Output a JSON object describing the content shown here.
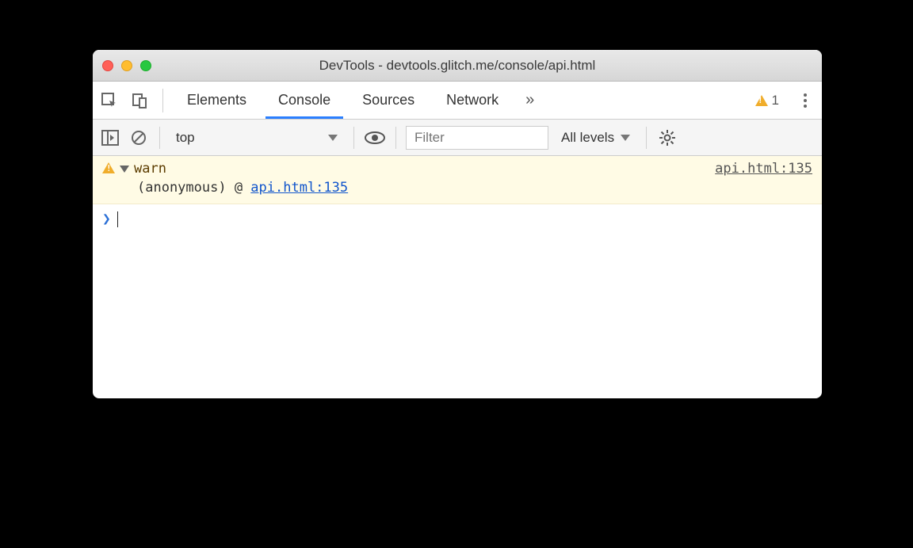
{
  "window": {
    "title": "DevTools - devtools.glitch.me/console/api.html"
  },
  "tabs": {
    "items": [
      "Elements",
      "Console",
      "Sources",
      "Network"
    ],
    "active_index": 1,
    "warning_count": "1"
  },
  "toolbar": {
    "context": "top",
    "filter_placeholder": "Filter",
    "levels_label": "All levels"
  },
  "log": {
    "label": "warn",
    "source": "api.html:135",
    "stack_prefix": "(anonymous) @ ",
    "stack_link": "api.html:135"
  }
}
